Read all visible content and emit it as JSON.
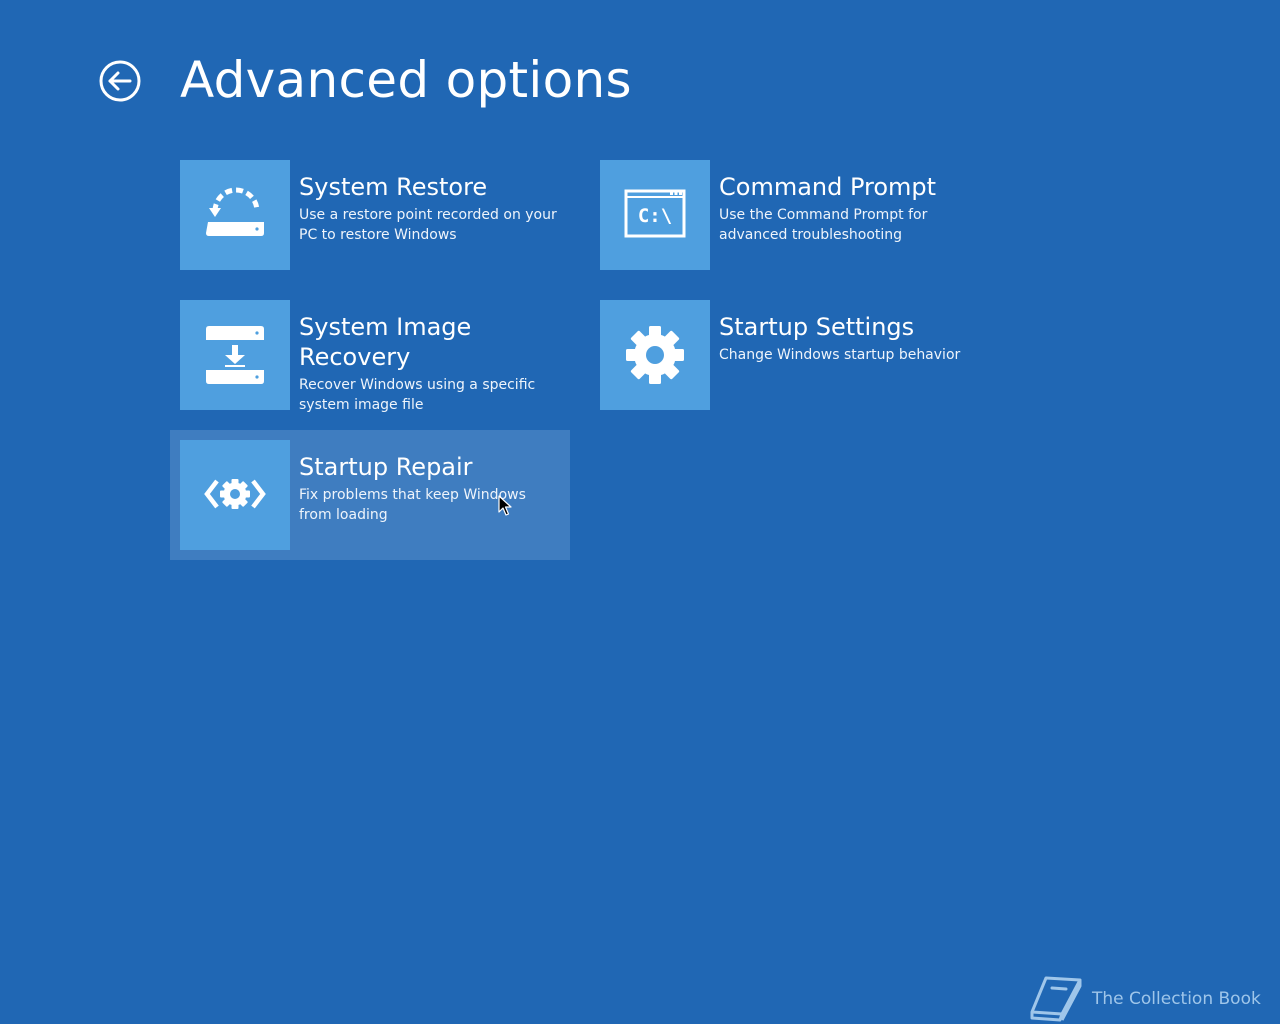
{
  "header": {
    "title": "Advanced options",
    "back_icon": "back-arrow-circle-icon"
  },
  "options": [
    {
      "title": "System Restore",
      "description": "Use a restore point recorded on your PC to restore Windows",
      "icon": "system-restore-icon",
      "selected": false
    },
    {
      "title": "Command Prompt",
      "description": "Use the Command Prompt for advanced troubleshooting",
      "icon": "command-prompt-icon",
      "icon_text": "C:\\",
      "selected": false
    },
    {
      "title": "System Image Recovery",
      "description": "Recover Windows using a specific system image file",
      "icon": "system-image-recovery-icon",
      "selected": false
    },
    {
      "title": "Startup Settings",
      "description": "Change Windows startup behavior",
      "icon": "gear-icon",
      "selected": false
    },
    {
      "title": "Startup Repair",
      "description": "Fix problems that keep Windows from loading",
      "icon": "startup-repair-icon",
      "selected": true
    }
  ],
  "watermark": {
    "text": "The Collection Book",
    "icon": "book-icon"
  },
  "colors": {
    "background": "#2067b4",
    "tile_icon_background": "#4f9fdf",
    "selected_highlight": "#3f7dc0",
    "text": "#ffffff"
  }
}
